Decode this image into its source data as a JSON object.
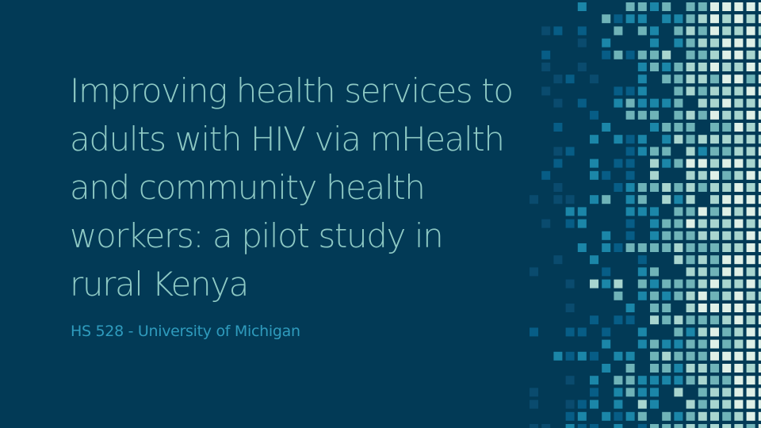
{
  "slide": {
    "title": "Improving health services to\nadults with HIV via mHealth\nand community health\nworkers: a pilot study in\nrural Kenya",
    "subtitle": "HS 528 - University of Michigan"
  },
  "theme": {
    "background": "#023a56",
    "title_color": "#8ec9c4",
    "subtitle_color": "#2f9bbd",
    "mosaic_colors": [
      "#0a4b6e",
      "#075d86",
      "#1b86a8",
      "#6fb3b8",
      "#a8d5cf",
      "#dff0e7"
    ]
  },
  "decoration": {
    "name": "pixel-mosaic"
  }
}
